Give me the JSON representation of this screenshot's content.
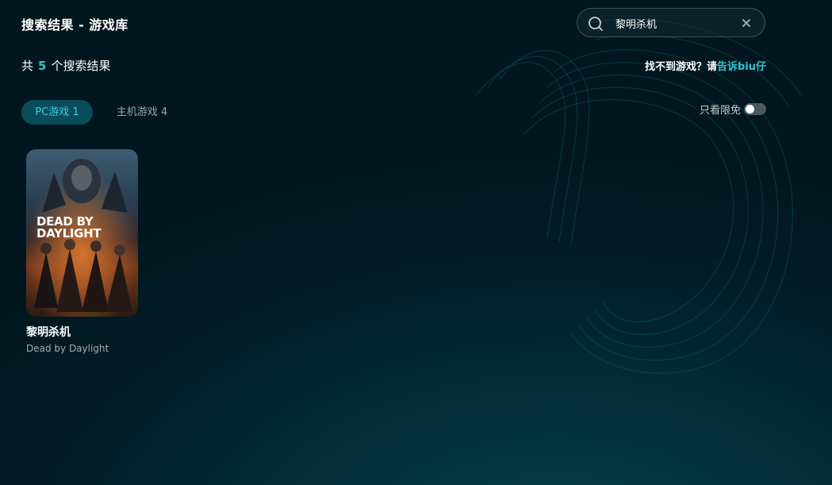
{
  "header": {
    "title": "搜索结果 - 游戏库"
  },
  "search": {
    "value": "黎明杀机",
    "placeholder": ""
  },
  "results": {
    "prefix": "共",
    "count": "5",
    "suffix": "个搜索结果"
  },
  "help": {
    "text": "找不到游戏？请",
    "link": "告诉biu仔"
  },
  "tabs": [
    {
      "label": "PC游戏 1",
      "active": true
    },
    {
      "label": "主机游戏 4",
      "active": false
    }
  ],
  "filter": {
    "label": "只看限免",
    "on": false
  },
  "games": [
    {
      "title": "黎明杀机",
      "subtitle": "Dead by Daylight",
      "cover_text": [
        "DEAD BY",
        "DAYLIGHT"
      ]
    }
  ],
  "colors": {
    "accent": "#31c6d6",
    "tab_active_bg": "#0b4c5c"
  }
}
